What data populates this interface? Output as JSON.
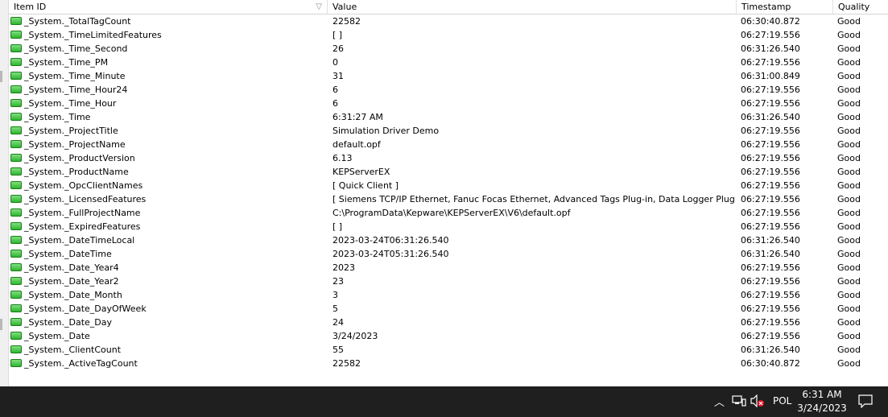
{
  "columns": {
    "item_id": "Item ID",
    "value": "Value",
    "timestamp": "Timestamp",
    "quality": "Quality"
  },
  "rows": [
    {
      "id": "_System._TotalTagCount",
      "value": "22582",
      "ts": "06:30:40.872",
      "q": "Good"
    },
    {
      "id": "_System._TimeLimitedFeatures",
      "value": "[  ]",
      "ts": "06:27:19.556",
      "q": "Good"
    },
    {
      "id": "_System._Time_Second",
      "value": "26",
      "ts": "06:31:26.540",
      "q": "Good"
    },
    {
      "id": "_System._Time_PM",
      "value": "0",
      "ts": "06:27:19.556",
      "q": "Good"
    },
    {
      "id": "_System._Time_Minute",
      "value": "31",
      "ts": "06:31:00.849",
      "q": "Good"
    },
    {
      "id": "_System._Time_Hour24",
      "value": "6",
      "ts": "06:27:19.556",
      "q": "Good"
    },
    {
      "id": "_System._Time_Hour",
      "value": "6",
      "ts": "06:27:19.556",
      "q": "Good"
    },
    {
      "id": "_System._Time",
      "value": "6:31:27 AM",
      "ts": "06:31:26.540",
      "q": "Good"
    },
    {
      "id": "_System._ProjectTitle",
      "value": "Simulation Driver Demo",
      "ts": "06:27:19.556",
      "q": "Good"
    },
    {
      "id": "_System._ProjectName",
      "value": "default.opf",
      "ts": "06:27:19.556",
      "q": "Good"
    },
    {
      "id": "_System._ProductVersion",
      "value": "6.13",
      "ts": "06:27:19.556",
      "q": "Good"
    },
    {
      "id": "_System._ProductName",
      "value": "KEPServerEX",
      "ts": "06:27:19.556",
      "q": "Good"
    },
    {
      "id": "_System._OpcClientNames",
      "value": "[ Quick Client ]",
      "ts": "06:27:19.556",
      "q": "Good"
    },
    {
      "id": "_System._LicensedFeatures",
      "value": "[ Siemens TCP/IP Ethernet, Fanuc Focas Ethernet, Advanced Tags Plug-in, Data Logger Plug...",
      "ts": "06:27:19.556",
      "q": "Good"
    },
    {
      "id": "_System._FullProjectName",
      "value": "C:\\ProgramData\\Kepware\\KEPServerEX\\V6\\default.opf",
      "ts": "06:27:19.556",
      "q": "Good"
    },
    {
      "id": "_System._ExpiredFeatures",
      "value": "[  ]",
      "ts": "06:27:19.556",
      "q": "Good"
    },
    {
      "id": "_System._DateTimeLocal",
      "value": "2023-03-24T06:31:26.540",
      "ts": "06:31:26.540",
      "q": "Good"
    },
    {
      "id": "_System._DateTime",
      "value": "2023-03-24T05:31:26.540",
      "ts": "06:31:26.540",
      "q": "Good"
    },
    {
      "id": "_System._Date_Year4",
      "value": "2023",
      "ts": "06:27:19.556",
      "q": "Good"
    },
    {
      "id": "_System._Date_Year2",
      "value": "23",
      "ts": "06:27:19.556",
      "q": "Good"
    },
    {
      "id": "_System._Date_Month",
      "value": "3",
      "ts": "06:27:19.556",
      "q": "Good"
    },
    {
      "id": "_System._Date_DayOfWeek",
      "value": "5",
      "ts": "06:27:19.556",
      "q": "Good"
    },
    {
      "id": "_System._Date_Day",
      "value": "24",
      "ts": "06:27:19.556",
      "q": "Good"
    },
    {
      "id": "_System._Date",
      "value": "3/24/2023",
      "ts": "06:27:19.556",
      "q": "Good"
    },
    {
      "id": "_System._ClientCount",
      "value": "55",
      "ts": "06:31:26.540",
      "q": "Good"
    },
    {
      "id": "_System._ActiveTagCount",
      "value": "22582",
      "ts": "06:30:40.872",
      "q": "Good"
    }
  ],
  "taskbar": {
    "language": "POL",
    "time": "6:31 AM",
    "date": "3/24/2023",
    "icons": [
      "chevron-up-icon",
      "network-icon",
      "volume-muted-icon",
      "notifications-icon"
    ]
  },
  "colors": {
    "tag_icon": "#2fb52f",
    "taskbar_bg": "#1f1f1f",
    "muted_badge": "#e81123"
  }
}
